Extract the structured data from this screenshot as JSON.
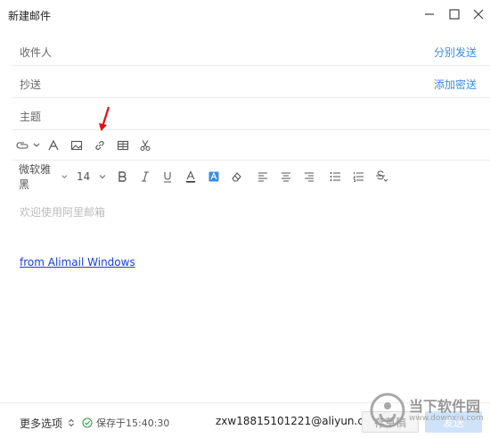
{
  "window": {
    "title": "新建邮件"
  },
  "fields": {
    "to_label": "收件人",
    "to_action": "分别发送",
    "cc_label": "抄送",
    "cc_action": "添加密送",
    "subject_label": "主题"
  },
  "toolbar": {
    "icons": [
      "attachment-icon",
      "font-icon",
      "image-icon",
      "link-icon",
      "table-icon",
      "scissors-icon"
    ]
  },
  "format": {
    "font_family": "微软雅黑",
    "font_size": "14"
  },
  "editor": {
    "placeholder": "欢迎使用阿里邮箱",
    "signature": "from Alimail Windows"
  },
  "footer": {
    "more_options": "更多选项",
    "saved_status": "保存于15:40:30",
    "account": "zxw18815101221@aliyun.com",
    "draft_label": "存草稿",
    "send_label": "发送"
  },
  "watermark": {
    "name": "当下软件园",
    "url": "www.downxia.com"
  },
  "colors": {
    "link": "#3b8ee0",
    "signature": "#1a3fd6",
    "annotation_arrow": "#e01010"
  }
}
